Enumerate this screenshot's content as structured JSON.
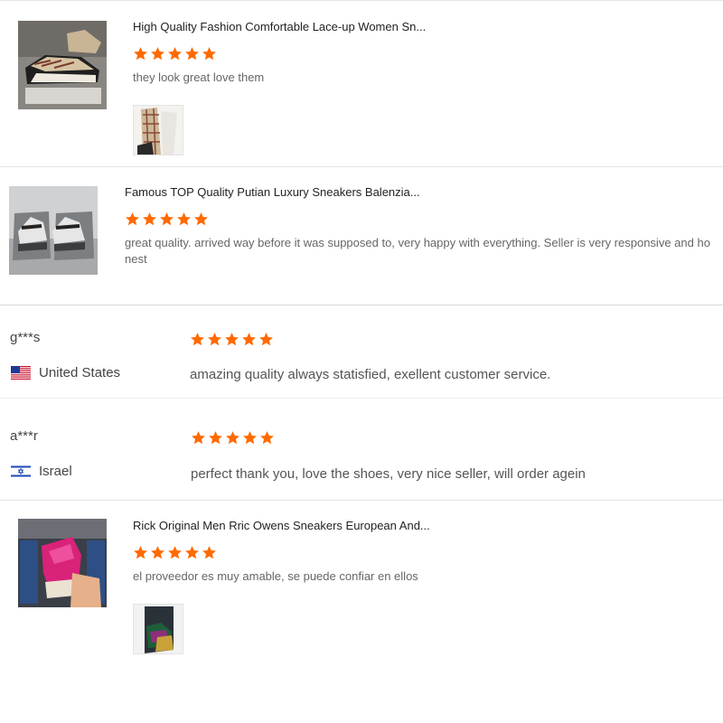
{
  "colors": {
    "star": "#ff6a00",
    "divider": "#e3e3e3"
  },
  "product_reviews": [
    {
      "product_title": "High Quality Fashion Comfortable Lace-up Women Sn...",
      "rating": 5,
      "text": "they look great love them",
      "photo_count": 1
    },
    {
      "product_title": "Famous TOP Quality Putian Luxury Sneakers Balenzia...",
      "rating": 5,
      "text": "great quality. arrived way before it was supposed to, very happy with everything. Seller is very responsive and honest",
      "photo_count": 0
    },
    {
      "product_title": "Rick Original Men Rric Owens Sneakers European And...",
      "rating": 5,
      "text": "el proveedor es muy amable, se puede confiar en ellos",
      "photo_count": 1
    }
  ],
  "user_reviews": [
    {
      "username": "g***s",
      "country": "United States",
      "flag_icon": "us-flag-icon",
      "rating": 5,
      "text": "amazing quality always statisfied, exellent customer service."
    },
    {
      "username": "a***r",
      "country": "Israel",
      "flag_icon": "israel-flag-icon",
      "rating": 5,
      "text": "perfect thank you, love the shoes, very nice seller, will order agein"
    }
  ]
}
